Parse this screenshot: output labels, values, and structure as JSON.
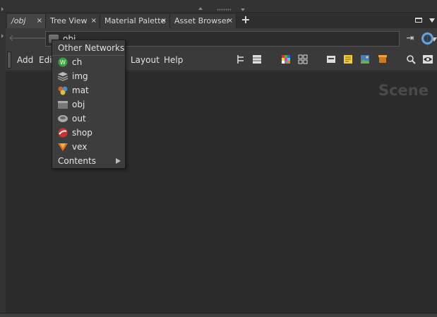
{
  "tabs": [
    {
      "label": "/obj",
      "active": true
    },
    {
      "label": "Tree View",
      "active": false
    },
    {
      "label": "Material Palette",
      "active": false
    },
    {
      "label": "Asset Browser",
      "active": false
    }
  ],
  "tab_close_glyph": "×",
  "tab_add_glyph": "+",
  "path": {
    "value": "obj"
  },
  "nav": {
    "back_glyph": "🡐",
    "forward_glyph": "🡒"
  },
  "pin_glyph": "⇥",
  "menu": {
    "add": "Add",
    "edit": "Edit",
    "layout": "Layout",
    "help": "Help"
  },
  "main": {
    "network_label": "Scene"
  },
  "popup": {
    "header": "Other Networks",
    "items": [
      {
        "label": "ch",
        "icon": "ch-network-icon",
        "color": "#3aa23a"
      },
      {
        "label": "img",
        "icon": "img-network-icon",
        "color": "#9a9a9a"
      },
      {
        "label": "mat",
        "icon": "mat-network-icon",
        "color": "#d06030"
      },
      {
        "label": "obj",
        "icon": "obj-network-icon",
        "color": "#8a8a8a"
      },
      {
        "label": "out",
        "icon": "out-network-icon",
        "color": "#b0b0b0"
      },
      {
        "label": "shop",
        "icon": "shop-network-icon",
        "color": "#d03030"
      },
      {
        "label": "vex",
        "icon": "vex-network-icon",
        "color": "#e07020"
      }
    ],
    "contents": "Contents"
  },
  "colors": {
    "accent": "#6aa3d8",
    "background": "#2b2b2b",
    "panel": "#3a3a3a"
  }
}
